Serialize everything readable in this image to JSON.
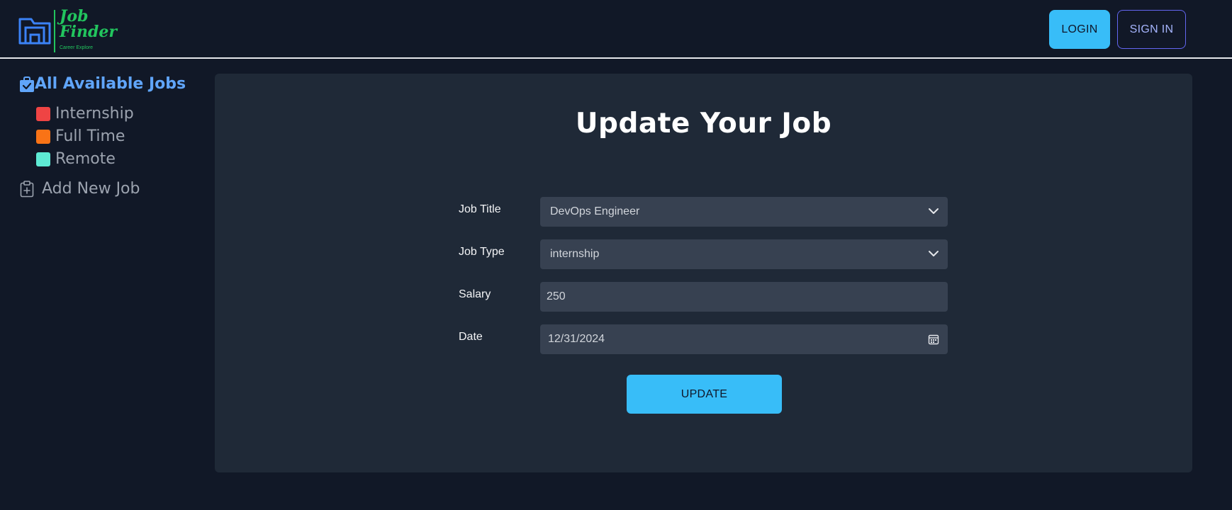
{
  "header": {
    "logo_line1": "Job",
    "logo_line2": "Finder",
    "logo_tagline": "Career Explore",
    "login_label": "LOGIN",
    "signin_label": "SIGN IN"
  },
  "sidebar": {
    "all_jobs_label": "All Available Jobs",
    "items": [
      {
        "label": "Internship",
        "color": "#ef4444"
      },
      {
        "label": "Full Time",
        "color": "#f97316"
      },
      {
        "label": "Remote",
        "color": "#5eead4"
      }
    ],
    "add_job_label": "Add New Job"
  },
  "form": {
    "title": "Update Your Job",
    "job_title_label": "Job Title",
    "job_title_value": "DevOps Engineer",
    "job_type_label": "Job Type",
    "job_type_value": "internship",
    "salary_label": "Salary",
    "salary_value": "250",
    "date_label": "Date",
    "date_value": "12/31/2024",
    "update_label": "UPDATE"
  },
  "colors": {
    "background": "#111827",
    "card": "#1f2937",
    "field": "#374151",
    "accent": "#38bdf8",
    "brand_green": "#22c55e",
    "sidebar_active": "#60a5fa"
  },
  "icons": {
    "logo": "folder-building-icon",
    "all_jobs": "briefcase-check-icon",
    "add_job": "clipboard-plus-icon",
    "select": "chevron-down-icon",
    "date": "calendar-icon"
  }
}
